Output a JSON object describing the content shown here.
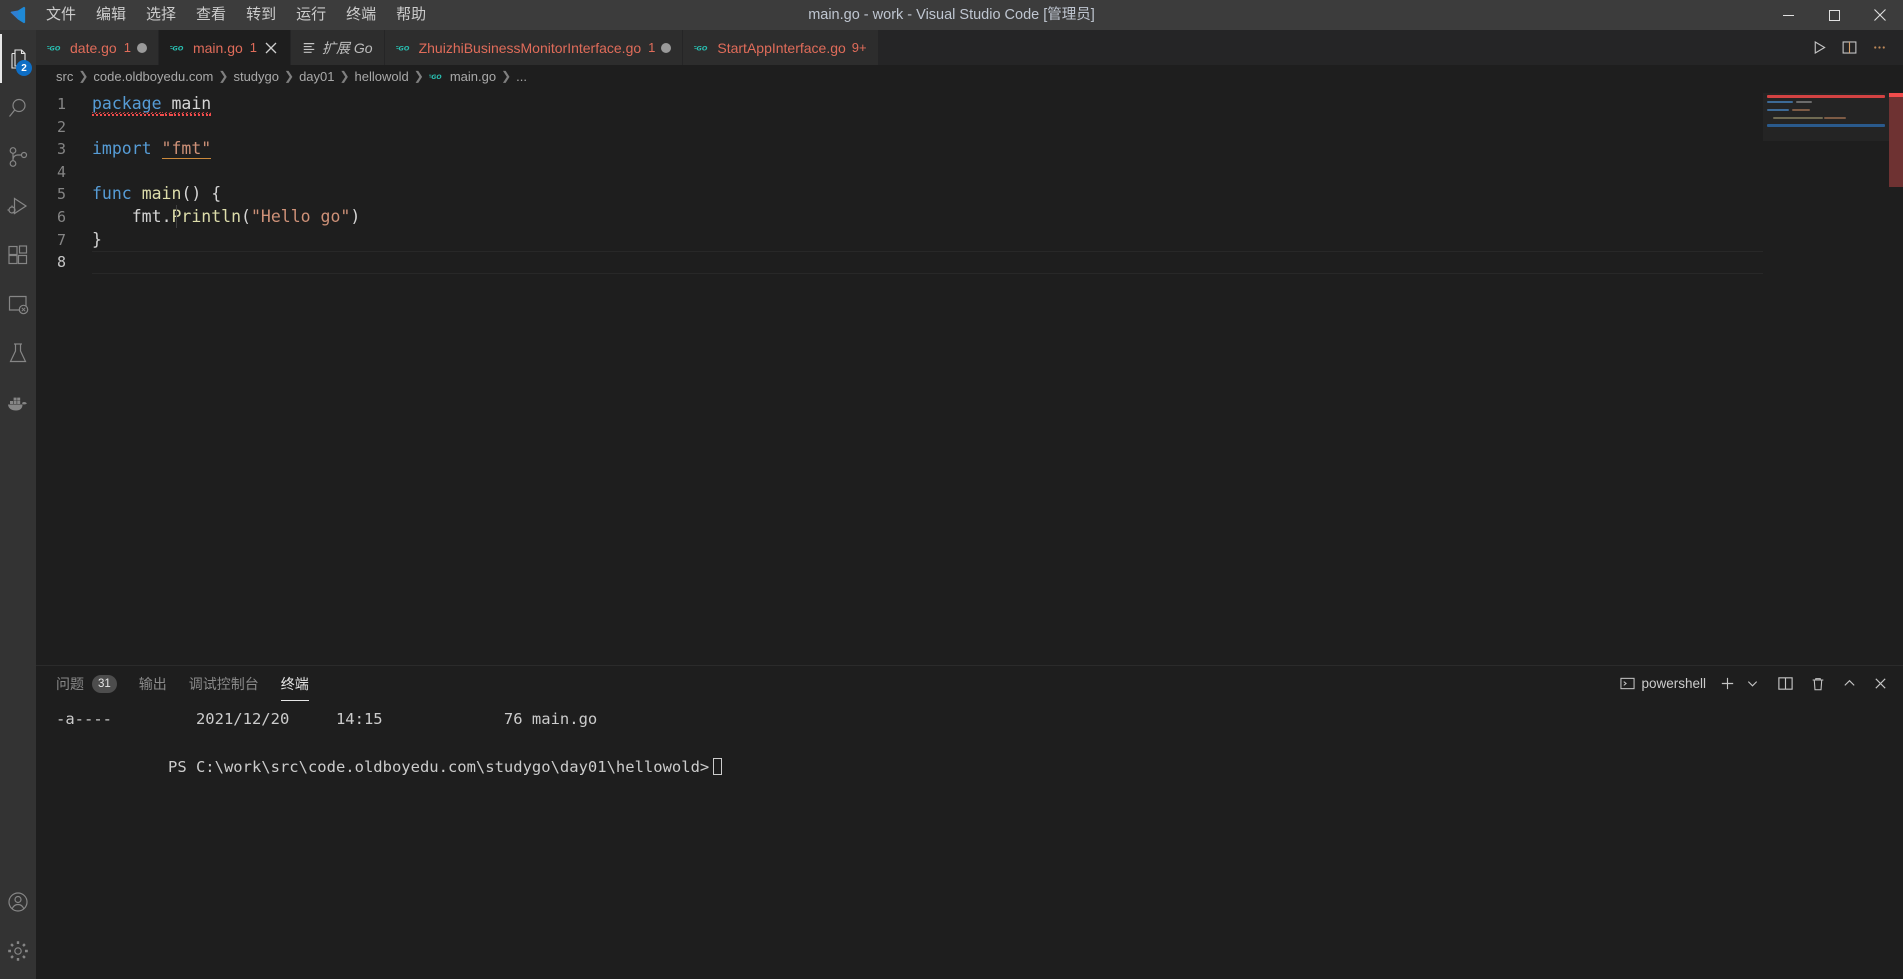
{
  "window": {
    "title": "main.go - work - Visual Studio Code [管理员]",
    "logo_icon": "vscode-logo-icon",
    "controls": {
      "minimize": "minimize-icon",
      "maximize": "maximize-icon",
      "close": "close-icon"
    }
  },
  "menubar": {
    "items": [
      {
        "label": "文件",
        "name": "menu-file"
      },
      {
        "label": "编辑",
        "name": "menu-edit"
      },
      {
        "label": "选择",
        "name": "menu-selection"
      },
      {
        "label": "查看",
        "name": "menu-view"
      },
      {
        "label": "转到",
        "name": "menu-go"
      },
      {
        "label": "运行",
        "name": "menu-run"
      },
      {
        "label": "终端",
        "name": "menu-terminal"
      },
      {
        "label": "帮助",
        "name": "menu-help"
      }
    ]
  },
  "activitybar": {
    "items": [
      {
        "name": "explorer-icon",
        "badge": "2",
        "active": true
      },
      {
        "name": "search-icon",
        "badge": "",
        "active": false
      },
      {
        "name": "source-control-icon",
        "badge": "",
        "active": false
      },
      {
        "name": "run-and-debug-icon",
        "badge": "",
        "active": false
      },
      {
        "name": "extensions-icon",
        "badge": "",
        "active": false
      },
      {
        "name": "remote-explorer-icon",
        "badge": "",
        "active": false
      },
      {
        "name": "testing-flask-icon",
        "badge": "",
        "active": false
      },
      {
        "name": "docker-icon",
        "badge": "",
        "active": false
      }
    ],
    "bottom": [
      {
        "name": "account-icon"
      },
      {
        "name": "manage-settings-gear-icon"
      }
    ]
  },
  "tabs": [
    {
      "label": "date.go",
      "icon": "go-file-icon",
      "error_count": "1",
      "dirty": true,
      "active": false,
      "italic": false,
      "closable": false
    },
    {
      "label": "main.go",
      "icon": "go-file-icon",
      "error_count": "1",
      "dirty": false,
      "active": true,
      "italic": false,
      "closable": true
    },
    {
      "label": "扩展 Go",
      "icon": "extension-page-icon",
      "error_count": "",
      "dirty": false,
      "active": false,
      "italic": true,
      "closable": false
    },
    {
      "label": "ZhuizhiBusinessMonitorInterface.go",
      "icon": "go-file-icon",
      "error_count": "1",
      "dirty": true,
      "active": false,
      "italic": false,
      "closable": false
    },
    {
      "label": "StartAppInterface.go",
      "icon": "go-file-icon",
      "error_count": "9+",
      "dirty": false,
      "active": false,
      "italic": false,
      "closable": false
    }
  ],
  "editor_actions": [
    {
      "name": "run-go-file-button",
      "icon": "play-icon"
    },
    {
      "name": "split-editor-right-button",
      "icon": "split-editor-icon"
    },
    {
      "name": "more-actions-button",
      "icon": "ellipsis-icon"
    }
  ],
  "breadcrumb": {
    "items": [
      "src",
      "code.oldboyedu.com",
      "studygo",
      "day01",
      "hellowold"
    ],
    "file": "main.go",
    "file_icon": "go-file-icon",
    "overflow": "..."
  },
  "editor": {
    "language": "go",
    "lines": [
      {
        "num": "1",
        "tokens": [
          {
            "t": "package",
            "c": "kw",
            "squiggle": true
          },
          {
            "t": " ",
            "c": "punc",
            "squiggle": true
          },
          {
            "t": "main",
            "c": "pkgname",
            "squiggle": true
          }
        ]
      },
      {
        "num": "2",
        "tokens": []
      },
      {
        "num": "3",
        "tokens": [
          {
            "t": "import",
            "c": "kw"
          },
          {
            "t": " ",
            "c": "punc"
          },
          {
            "t": "\"fmt\"",
            "c": "str",
            "warn": true
          }
        ]
      },
      {
        "num": "4",
        "tokens": []
      },
      {
        "num": "5",
        "tokens": [
          {
            "t": "func",
            "c": "kw"
          },
          {
            "t": " ",
            "c": "punc"
          },
          {
            "t": "main",
            "c": "fn"
          },
          {
            "t": "() {",
            "c": "punc"
          }
        ]
      },
      {
        "num": "6",
        "indent": true,
        "tokens": [
          {
            "t": "    ",
            "c": "punc"
          },
          {
            "t": "fmt",
            "c": "ident"
          },
          {
            "t": ".",
            "c": "punc"
          },
          {
            "t": "Println",
            "c": "fn"
          },
          {
            "t": "(",
            "c": "punc"
          },
          {
            "t": "\"Hello go\"",
            "c": "str"
          },
          {
            "t": ")",
            "c": "punc"
          }
        ]
      },
      {
        "num": "7",
        "tokens": [
          {
            "t": "}",
            "c": "punc"
          }
        ]
      },
      {
        "num": "8",
        "current": true,
        "tokens": []
      }
    ],
    "minimap_enabled": true
  },
  "panel": {
    "tabs": [
      {
        "label": "问题",
        "badge": "31",
        "active": false,
        "name": "panel-tab-problems"
      },
      {
        "label": "输出",
        "badge": "",
        "active": false,
        "name": "panel-tab-output"
      },
      {
        "label": "调试控制台",
        "badge": "",
        "active": false,
        "name": "panel-tab-debug-console"
      },
      {
        "label": "终端",
        "badge": "",
        "active": true,
        "name": "panel-tab-terminal"
      }
    ],
    "terminal_name": "powershell",
    "actions": [
      {
        "name": "launch-profile-icon",
        "icon": "terminal-icon"
      },
      {
        "name": "new-terminal-button",
        "icon": "plus-icon"
      },
      {
        "name": "terminal-profile-dropdown",
        "icon": "chevron-down-icon"
      },
      {
        "name": "split-terminal-button",
        "icon": "split-icon"
      },
      {
        "name": "kill-terminal-button",
        "icon": "trash-icon"
      },
      {
        "name": "collapse-panel-button",
        "icon": "chevron-up-icon"
      },
      {
        "name": "close-panel-button",
        "icon": "close-icon"
      }
    ]
  },
  "terminal": {
    "output_lines": [
      "-a----         2021/12/20     14:15             76 main.go",
      ""
    ],
    "prompt": "PS C:\\work\\src\\code.oldboyedu.com\\studygo\\day01\\hellowold>"
  },
  "colors": {
    "titlebar_bg": "#3c3c3c",
    "activitybar_bg": "#333333",
    "editor_bg": "#1e1e1e",
    "tabbar_bg": "#252526",
    "accent_blue": "#0e6ec5",
    "error_red": "#f14c4c",
    "tab_filename": "#e06c5a",
    "keyword": "#569cd6",
    "string": "#ce9178",
    "function": "#dcdcaa",
    "go_icon": "#29beb0"
  }
}
